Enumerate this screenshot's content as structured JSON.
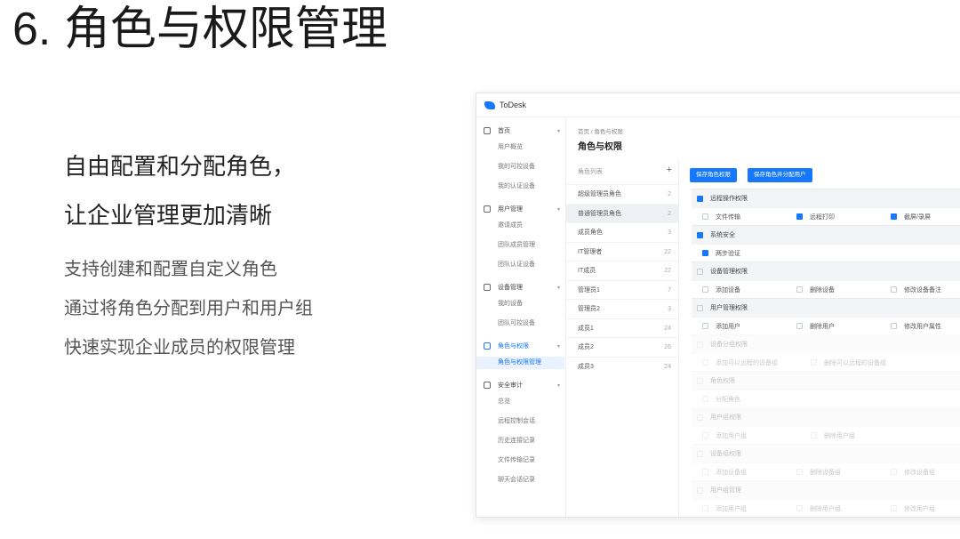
{
  "slide": {
    "title": "6. 角色与权限管理",
    "headline": [
      "自由配置和分配角色，",
      "让企业管理更加清晰"
    ],
    "description": [
      "支持创建和配置自定义角色",
      "通过将角色分配到用户和用户组",
      "快速实现企业成员的权限管理"
    ]
  },
  "app": {
    "name": "ToDesk",
    "sidebar": {
      "groups": [
        {
          "icon": "home-icon",
          "label": "首页",
          "items": [
            "用户概览",
            "我的可控设备",
            "我的认证设备"
          ]
        },
        {
          "icon": "user-icon",
          "label": "用户管理",
          "items": [
            "邀请成员",
            "团队成员管理",
            "团队认证设备"
          ]
        },
        {
          "icon": "monitor-icon",
          "label": "设备管理",
          "items": [
            "我的设备",
            "团队可控设备"
          ]
        },
        {
          "icon": "shield-icon",
          "label": "角色与权限",
          "items": [
            "角色与权限管理"
          ]
        },
        {
          "icon": "audit-icon",
          "label": "安全审计",
          "items": [
            "总览",
            "远程控制会话",
            "历史连接记录",
            "文件传输记录",
            "聊天会话记录"
          ]
        }
      ]
    },
    "breadcrumb": "首页 / 角色与权限",
    "page_title": "角色与权限",
    "roles": {
      "header": "角色列表",
      "add_label": "+",
      "items": [
        {
          "name": "超级管理员角色",
          "count": "2"
        },
        {
          "name": "普通管理员角色",
          "count": "2"
        },
        {
          "name": "成员角色",
          "count": "3"
        },
        {
          "name": "IT管理者",
          "count": "22"
        },
        {
          "name": "IT成员",
          "count": "22"
        },
        {
          "name": "管理员1",
          "count": "7"
        },
        {
          "name": "管理员2",
          "count": "3"
        },
        {
          "name": "成员1",
          "count": "24"
        },
        {
          "name": "成员2",
          "count": "26"
        },
        {
          "name": "成员3",
          "count": "24"
        }
      ]
    },
    "permissions": {
      "buttons": [
        "保存角色权限",
        "保存角色并分配用户"
      ],
      "sections": [
        {
          "label": "远程操作权限",
          "checked": true,
          "rows": [
            [
              {
                "label": "文件传输",
                "checked": false
              },
              {
                "label": "远程打印",
                "checked": true
              },
              {
                "label": "截屏/录屏",
                "checked": true
              }
            ]
          ]
        },
        {
          "label": "系统安全",
          "checked": true,
          "rows": [
            [
              {
                "label": "两步验证",
                "checked": true
              }
            ]
          ]
        },
        {
          "label": "设备管理权限",
          "checked": false,
          "rows": [
            [
              {
                "label": "添加设备",
                "checked": false
              },
              {
                "label": "删除设备",
                "checked": false
              },
              {
                "label": "修改设备备注",
                "checked": false
              }
            ]
          ]
        },
        {
          "label": "用户管理权限",
          "checked": false,
          "rows": [
            [
              {
                "label": "添加用户",
                "checked": false
              },
              {
                "label": "删除用户",
                "checked": false
              },
              {
                "label": "修改用户属性",
                "checked": false
              }
            ]
          ]
        },
        {
          "label": "设备分组权限",
          "checked": false,
          "faded": true,
          "rows": [
            [
              {
                "label": "添加可以远程的设备组",
                "checked": false,
                "faded": true
              },
              {
                "label": "删除可以远程的设备组",
                "checked": false,
                "faded": true
              }
            ]
          ]
        },
        {
          "label": "角色权限",
          "checked": false,
          "faded": true,
          "rows": [
            [
              {
                "label": "分配角色",
                "checked": false,
                "faded": true
              }
            ]
          ]
        },
        {
          "label": "用户组权限",
          "checked": false,
          "faded": true,
          "rows": [
            [
              {
                "label": "添加用户组",
                "checked": false,
                "faded": true
              },
              {
                "label": "删除用户组",
                "checked": false,
                "faded": true
              }
            ]
          ]
        },
        {
          "label": "设备组权限",
          "checked": false,
          "faded": true,
          "rows": [
            [
              {
                "label": "添加设备组",
                "checked": false,
                "faded": true
              },
              {
                "label": "删除设备组",
                "checked": false,
                "faded": true
              },
              {
                "label": "修改设备组",
                "checked": false,
                "faded": true
              }
            ]
          ]
        },
        {
          "label": "用户组管理",
          "checked": false,
          "faded": true,
          "rows": [
            [
              {
                "label": "添加用户组",
                "checked": false,
                "faded": true
              },
              {
                "label": "删除用户组",
                "checked": false,
                "faded": true
              },
              {
                "label": "修改用户组",
                "checked": false,
                "faded": true
              }
            ]
          ]
        }
      ]
    }
  },
  "colors": {
    "accent": "#1677ff",
    "text": "#222222",
    "muted": "#555555"
  }
}
